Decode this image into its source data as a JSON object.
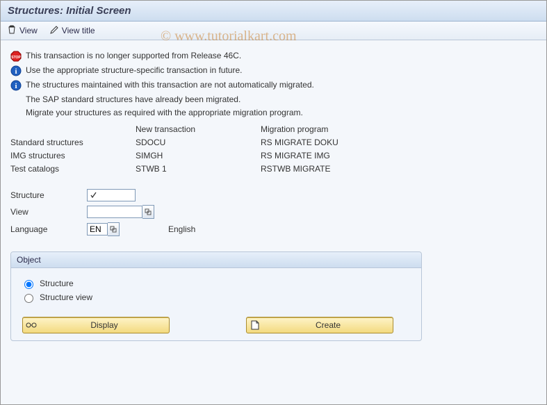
{
  "title": "Structures: Initial Screen",
  "toolbar": {
    "view_label": "View",
    "view_title_label": "View title"
  },
  "messages": {
    "m1": "This transaction is  no longer supported from Release 46C.",
    "m2": "Use the appropriate structure-specific transaction in future.",
    "m3": "The structures maintained with this transaction are not automatically migrated.",
    "m4": "The SAP standard structures have already been migrated.",
    "m5": "Migrate your structures as required with the appropriate migration program."
  },
  "table": {
    "hdr_new_tx": "New transaction",
    "hdr_mig_prog": "Migration program",
    "rows": [
      {
        "label": "Standard structures",
        "tx": "SDOCU",
        "prog": "RS MIGRATE DOKU"
      },
      {
        "label": "IMG structures",
        "tx": "SIMGH",
        "prog": "RS MIGRATE IMG"
      },
      {
        "label": "Test catalogs",
        "tx": "STWB 1",
        "prog": "RSTWB MIGRATE"
      }
    ]
  },
  "form": {
    "structure_label": "Structure",
    "structure_value": "",
    "view_label": "View",
    "view_value": "",
    "language_label": "Language",
    "language_value": "EN",
    "language_text": "English"
  },
  "group": {
    "title": "Object",
    "opt_structure": "Structure",
    "opt_structure_view": "Structure view",
    "btn_display": "Display",
    "btn_create": "Create"
  },
  "watermark": "© www.tutorialkart.com"
}
